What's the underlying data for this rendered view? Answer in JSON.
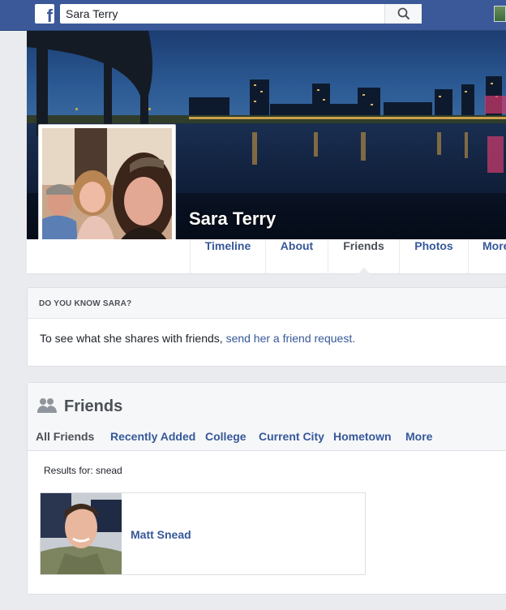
{
  "colors": {
    "brand": "#3b5998",
    "link": "#365899",
    "muted": "#4b4f56",
    "background": "#e9ebee"
  },
  "topbar": {
    "logo": "f",
    "search": {
      "value": "Sara Terry",
      "icon": "search-icon"
    }
  },
  "profile": {
    "name": "Sara Terry",
    "tabs": [
      {
        "label": "Timeline"
      },
      {
        "label": "About"
      },
      {
        "label": "Friends",
        "active": true
      },
      {
        "label": "Photos"
      },
      {
        "label": "More"
      }
    ]
  },
  "know_card": {
    "heading": "DO YOU KNOW SARA?",
    "text": "To see what she shares with friends,",
    "link": "send her a friend request."
  },
  "friends": {
    "title": "Friends",
    "icon": "friends-icon",
    "subtabs": [
      {
        "label": "All Friends",
        "active": true
      },
      {
        "label": "Recently Added"
      },
      {
        "label": "College"
      },
      {
        "label": "Current City"
      },
      {
        "label": "Hometown"
      },
      {
        "label": "More"
      }
    ],
    "results": "Results for: snead",
    "items": [
      {
        "name": "Matt Snead"
      }
    ]
  }
}
